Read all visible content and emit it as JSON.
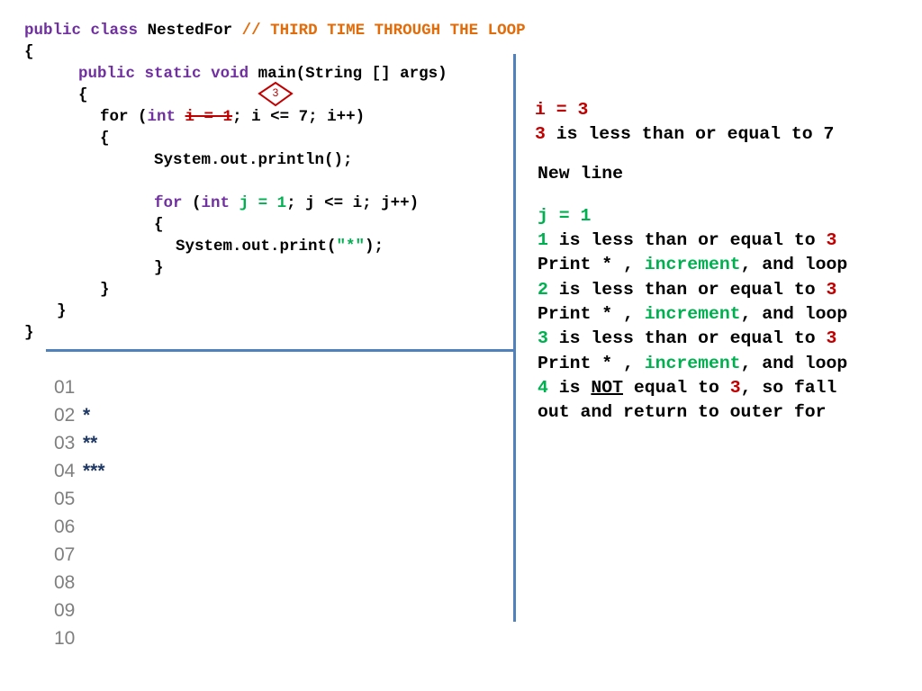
{
  "code": {
    "l1": {
      "kw1": "public",
      "kw2": "class",
      "name": "NestedFor",
      "comment": "// THIRD TIME THROUGH THE LOOP"
    },
    "l2": "{",
    "l3": {
      "kw1": "public",
      "kw2": "static",
      "kw3": "void",
      "rest": "main(String [] args)"
    },
    "l4": "{",
    "l5": {
      "pre": "for (",
      "kw": "int",
      "struck": "i = 1",
      "rest": "; i <= 7; i++)"
    },
    "l6": "{",
    "l7": "System.out.println();",
    "l9": {
      "kw1": "for",
      "p1": " (",
      "kw2": "int",
      "green": "j = 1",
      "rest": "; j <= i; j++)"
    },
    "l10": "{",
    "l11": {
      "pre": "System.out.print(",
      "str": "\"*\"",
      "post": ");"
    },
    "l12": "}",
    "l13": "}",
    "l14": "}",
    "l15": "}"
  },
  "badge": {
    "value": "3"
  },
  "explanation": {
    "i_eq": "i = 3",
    "i_val": "3",
    "i_cmp": " is less than or equal to 7",
    "new_line": "New line",
    "j_eq": "j = 1",
    "check1_num": "1",
    "check2_num": "2",
    "check3_num": "3",
    "check_text": " is less than or equal to ",
    "limit": "3",
    "print_pre": "Print * , ",
    "increment": "increment",
    "print_post": ", and loop",
    "final_num": "4",
    "final_is": " is ",
    "final_not": "NOT",
    "final_mid": " equal to ",
    "final_limit": "3",
    "final_tail": ", so fall",
    "final_line2": "out and return to outer for"
  },
  "output": {
    "lines": [
      {
        "num": "01",
        "stars": ""
      },
      {
        "num": "02",
        "stars": "*"
      },
      {
        "num": "03",
        "stars": "**"
      },
      {
        "num": "04",
        "stars": "***"
      },
      {
        "num": "05",
        "stars": ""
      },
      {
        "num": "06",
        "stars": ""
      },
      {
        "num": "07",
        "stars": ""
      },
      {
        "num": "08",
        "stars": ""
      },
      {
        "num": "09",
        "stars": ""
      },
      {
        "num": "10",
        "stars": ""
      }
    ]
  },
  "colors": {
    "keyword": "#7030A0",
    "comment": "#E36C0A",
    "green": "#00B050",
    "red": "#C00000",
    "grey": "#A6A6A6",
    "divider": "#4F81BD",
    "stars": "#1F3864"
  }
}
